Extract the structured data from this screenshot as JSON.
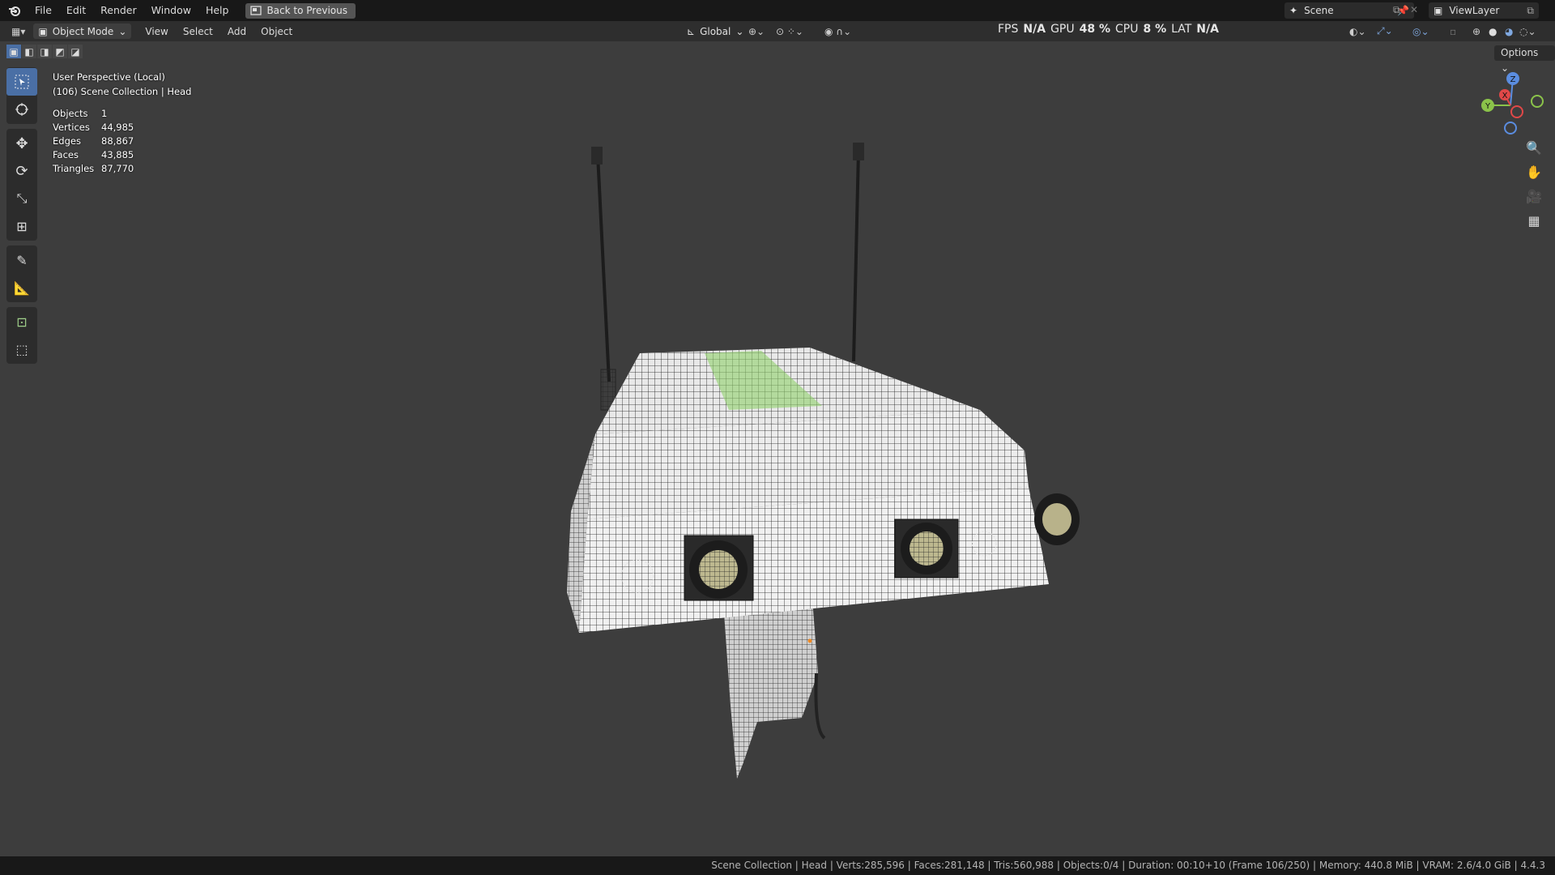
{
  "menubar": {
    "items": [
      "File",
      "Edit",
      "Render",
      "Window",
      "Help"
    ],
    "back_button": "Back to Previous",
    "scene": "Scene",
    "view_layer": "ViewLayer"
  },
  "header": {
    "mode": "Object Mode",
    "menus": [
      "View",
      "Select",
      "Add",
      "Object"
    ],
    "orientation": "Global",
    "options": "Options"
  },
  "perf": {
    "fps_label": "FPS",
    "fps_value": "N/A",
    "gpu_label": "GPU",
    "gpu_value": "48 %",
    "cpu_label": "CPU",
    "cpu_value": "8 %",
    "lat_label": "LAT",
    "lat_value": "N/A"
  },
  "viewport_info": {
    "perspective": "User Perspective (Local)",
    "collection": "(106) Scene Collection | Head",
    "stats": [
      {
        "label": "Objects",
        "value": "1"
      },
      {
        "label": "Vertices",
        "value": "44,985"
      },
      {
        "label": "Edges",
        "value": "88,867"
      },
      {
        "label": "Faces",
        "value": "43,885"
      },
      {
        "label": "Triangles",
        "value": "87,770"
      }
    ]
  },
  "gizmo": {
    "x": "X",
    "y": "Y",
    "z": "Z"
  },
  "statusbar": "Scene Collection | Head | Verts:285,596 | Faces:281,148 | Tris:560,988 | Objects:0/4 | Duration: 00:10+10 (Frame 106/250) | Memory: 440.8 MiB | VRAM: 2.6/4.0 GiB | 4.4.3",
  "colors": {
    "accent": "#4a6fa5",
    "viewport_bg": "#3d3d3d",
    "selection_green": "#8fd16a"
  }
}
